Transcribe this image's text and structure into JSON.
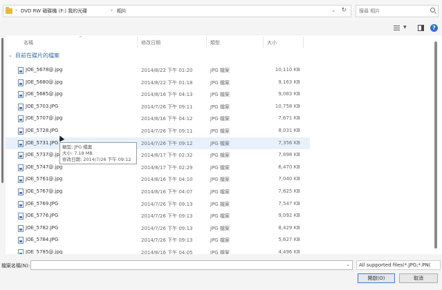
{
  "address": {
    "crumbs": [
      "DVD RW 磁碟機 (F:) 我的光碟",
      "相片"
    ],
    "search_placeholder": "搜尋 相片"
  },
  "columns": {
    "name": "名稱",
    "date": "修改日期",
    "type": "類型",
    "size": "大小"
  },
  "group_label": "目前在碟片的檔案",
  "files": [
    {
      "name": "JOE_5678@.jpg",
      "date": "2014/8/22 下午 01:20",
      "type": "JPG 檔案",
      "size": "10,110 KB"
    },
    {
      "name": "JOE_5680@.jpg",
      "date": "2014/8/22 下午 01:18",
      "type": "JPG 檔案",
      "size": "9,163 KB"
    },
    {
      "name": "JOE_5685@.jpg",
      "date": "2014/8/16 下午 04:13",
      "type": "JPG 檔案",
      "size": "9,083 KB"
    },
    {
      "name": "JOE_5703.JPG",
      "date": "2014/7/26 下午 09:11",
      "type": "JPG 檔案",
      "size": "10,758 KB"
    },
    {
      "name": "JOE_5707@.jpg",
      "date": "2014/8/16 下午 04:12",
      "type": "JPG 檔案",
      "size": "7,671 KB"
    },
    {
      "name": "JOE_5728.JPG",
      "date": "2014/7/26 下午 09:11",
      "type": "JPG 檔案",
      "size": "8,031 KB"
    },
    {
      "name": "JOE_5731.JPG",
      "date": "2014/7/26 下午 09:12",
      "type": "JPG 檔案",
      "size": "7,356 KB"
    },
    {
      "name": "JOE_5737@.jpg",
      "date": "2014/8/17 下午 02:32",
      "type": "JPG 檔案",
      "size": "7,898 KB"
    },
    {
      "name": "JOE_5747@.jpg",
      "date": "2014/8/17 下午 02:29",
      "type": "JPG 檔案",
      "size": "6,470 KB"
    },
    {
      "name": "JOE_5761@.jpg",
      "date": "2014/8/16 下午 04:10",
      "type": "JPG 檔案",
      "size": "7,040 KB"
    },
    {
      "name": "JOE_5767@.jpg",
      "date": "2014/8/16 下午 04:07",
      "type": "JPG 檔案",
      "size": "7,625 KB"
    },
    {
      "name": "JOE_5769.JPG",
      "date": "2014/7/26 下午 09:13",
      "type": "JPG 檔案",
      "size": "7,547 KB"
    },
    {
      "name": "JOE_5776.JPG",
      "date": "2014/7/26 下午 09:13",
      "type": "JPG 檔案",
      "size": "9,092 KB"
    },
    {
      "name": "JOE_5782.JPG",
      "date": "2014/7/26 下午 09:13",
      "type": "JPG 檔案",
      "size": "8,429 KB"
    },
    {
      "name": "JOE_5784.JPG",
      "date": "2014/7/26 下午 09:13",
      "type": "JPG 檔案",
      "size": "5,627 KB"
    },
    {
      "name": "JOE_5785@.jpg",
      "date": "2014/8/16 下午 04:05",
      "type": "JPG 檔案",
      "size": "4,496 KB"
    }
  ],
  "tooltip": {
    "type_line": "類型: JPG 檔案",
    "size_line": "大小: 7.18 MB",
    "date_line": "修改日期: 2014/7/26 下午 09:12"
  },
  "bottom": {
    "filename_label": "檔案名稱(N):",
    "filename_value": "",
    "filter": "All supported files(*.JPG;*.PN(",
    "open_label": "開啟(O)",
    "cancel_label": "取消"
  },
  "colors": {
    "accent": "#3a7bd5",
    "folder": "#e8b73a",
    "hover_row": "#e7f1fb"
  }
}
